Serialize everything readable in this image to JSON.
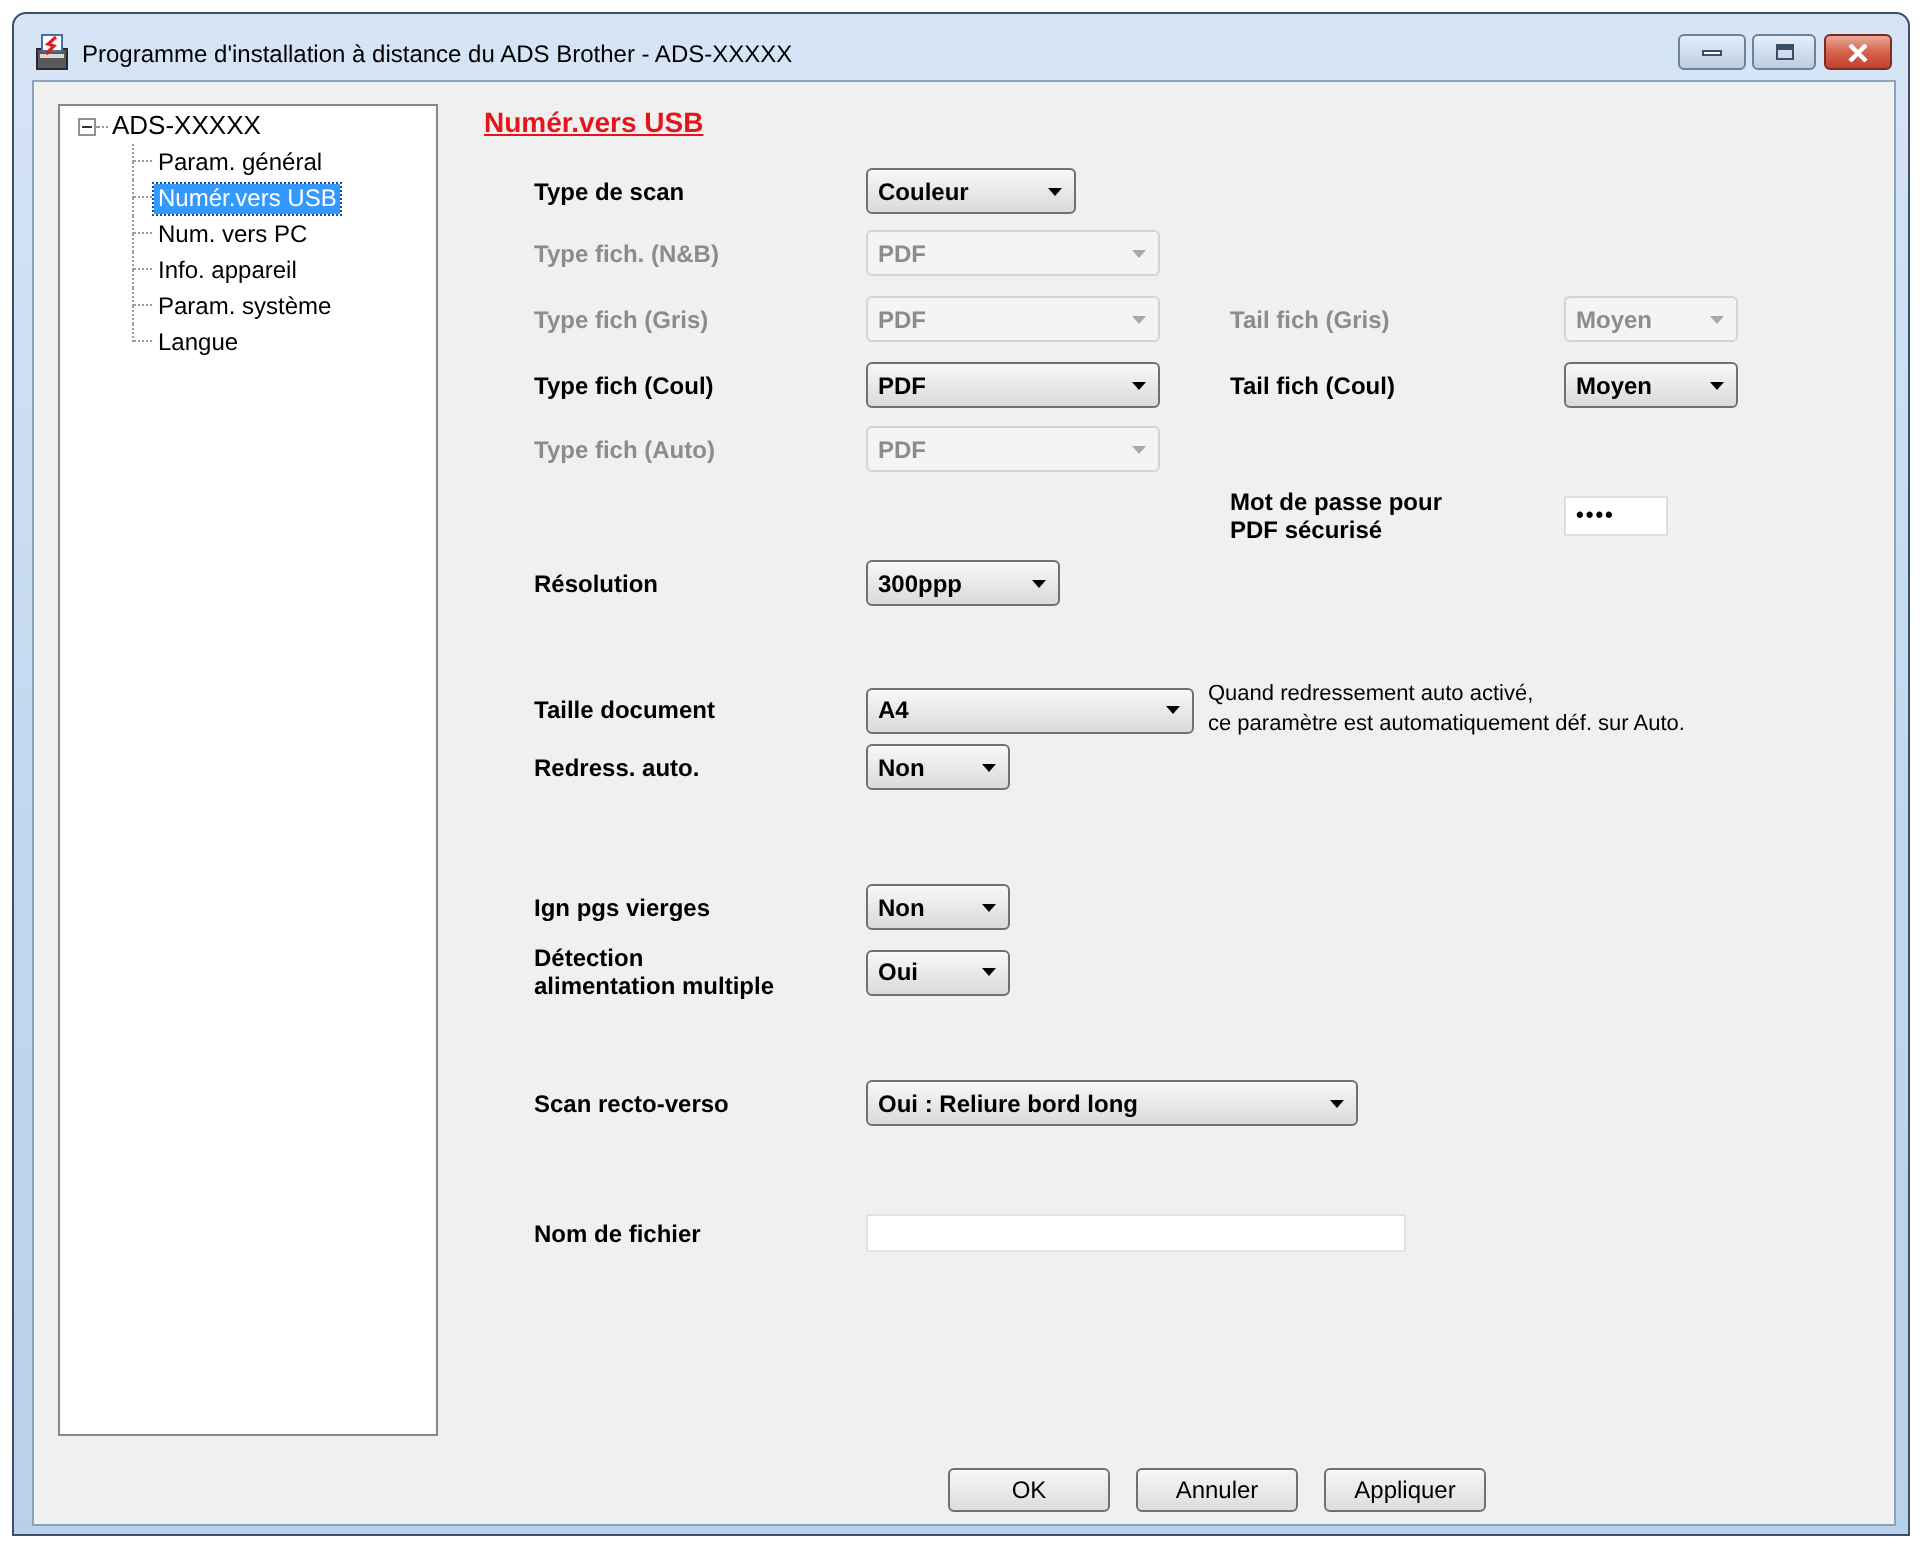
{
  "window": {
    "title": "Programme d'installation à distance du ADS Brother - ADS-XXXXX"
  },
  "tree": {
    "label": "ADS-XXXXX",
    "expanded": true,
    "children": [
      {
        "label": "Param. général",
        "selected": false
      },
      {
        "label": "Numér.vers USB",
        "selected": true
      },
      {
        "label": "Num. vers PC",
        "selected": false
      },
      {
        "label": "Info. appareil",
        "selected": false
      },
      {
        "label": "Param. système",
        "selected": false
      },
      {
        "label": "Langue",
        "selected": false
      }
    ]
  },
  "section_title": "Numér.vers USB",
  "rows": [
    {
      "left": {
        "kind": "dropdown",
        "label": "Type de scan",
        "value": "Couleur",
        "disabled": false
      }
    },
    {
      "left": {
        "kind": "dropdown",
        "label": "Type fich. (N&B)",
        "value": "PDF",
        "disabled": true
      }
    },
    {
      "left": {
        "kind": "dropdown",
        "label": "Type fich (Gris)",
        "value": "PDF",
        "disabled": true
      },
      "right": {
        "kind": "dropdown",
        "label": "Tail fich (Gris)",
        "value": "Moyen",
        "disabled": true
      }
    },
    {
      "left": {
        "kind": "dropdown",
        "label": "Type fich (Coul)",
        "value": "PDF",
        "disabled": false
      },
      "right": {
        "kind": "dropdown",
        "label": "Tail fich (Coul)",
        "value": "Moyen",
        "disabled": false
      }
    },
    {
      "left": {
        "kind": "dropdown",
        "label": "Type fich (Auto)",
        "value": "PDF",
        "disabled": true
      }
    },
    {
      "right": {
        "kind": "password",
        "label": "Mot de passe pour\nPDF sécurisé",
        "value": "••••"
      }
    },
    {
      "left": {
        "kind": "dropdown",
        "label": "Résolution",
        "value": "300ppp",
        "disabled": false
      }
    },
    {
      "left": {
        "kind": "dropdown",
        "label": "Taille document",
        "value": "A4",
        "disabled": false,
        "note": "Quand redressement auto activé,\nce paramètre est automatiquement déf. sur Auto."
      }
    },
    {
      "left": {
        "kind": "dropdown",
        "label": "Redress. auto.",
        "value": "Non",
        "disabled": false
      }
    },
    {
      "left": {
        "kind": "dropdown",
        "label": "Ign pgs vierges",
        "value": "Non",
        "disabled": false
      }
    },
    {
      "left": {
        "kind": "dropdown",
        "label": "Détection\nalimentation multiple",
        "value": "Oui",
        "disabled": false
      }
    },
    {
      "left": {
        "kind": "dropdown",
        "label": "Scan recto-verso",
        "value": "Oui : Reliure bord long",
        "disabled": false
      }
    },
    {
      "left": {
        "kind": "text",
        "label": "Nom de fichier"
      }
    }
  ],
  "buttons": [
    {
      "label": "OK"
    },
    {
      "label": "Annuler"
    },
    {
      "label": "Appliquer"
    }
  ]
}
